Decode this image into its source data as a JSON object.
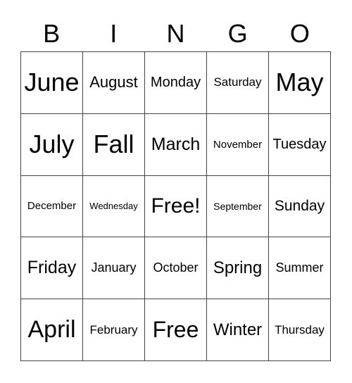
{
  "header": [
    "B",
    "I",
    "N",
    "G",
    "O"
  ],
  "rows": [
    [
      {
        "text": "June",
        "size": 36
      },
      {
        "text": "August",
        "size": 22
      },
      {
        "text": "Monday",
        "size": 20
      },
      {
        "text": "Saturday",
        "size": 17
      },
      {
        "text": "May",
        "size": 36
      }
    ],
    [
      {
        "text": "July",
        "size": 36
      },
      {
        "text": "Fall",
        "size": 36
      },
      {
        "text": "March",
        "size": 25
      },
      {
        "text": "November",
        "size": 15
      },
      {
        "text": "Tuesday",
        "size": 20
      }
    ],
    [
      {
        "text": "December",
        "size": 15
      },
      {
        "text": "Wednesday",
        "size": 13
      },
      {
        "text": "Free!",
        "size": 30
      },
      {
        "text": "September",
        "size": 14
      },
      {
        "text": "Sunday",
        "size": 21
      }
    ],
    [
      {
        "text": "Friday",
        "size": 25
      },
      {
        "text": "January",
        "size": 18
      },
      {
        "text": "October",
        "size": 18
      },
      {
        "text": "Spring",
        "size": 24
      },
      {
        "text": "Summer",
        "size": 18
      }
    ],
    [
      {
        "text": "April",
        "size": 34
      },
      {
        "text": "February",
        "size": 17
      },
      {
        "text": "Free",
        "size": 32
      },
      {
        "text": "Winter",
        "size": 24
      },
      {
        "text": "Thursday",
        "size": 17
      }
    ]
  ]
}
